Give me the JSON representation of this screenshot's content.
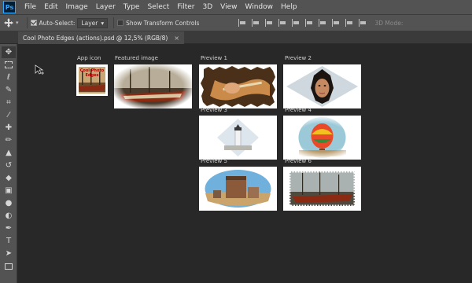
{
  "app": {
    "logo_text": "Ps"
  },
  "menu": [
    "File",
    "Edit",
    "Image",
    "Layer",
    "Type",
    "Select",
    "Filter",
    "3D",
    "View",
    "Window",
    "Help"
  ],
  "options": {
    "auto_select_label": "Auto-Select:",
    "auto_select_checked": true,
    "auto_select_value": "Layer",
    "show_transform_label": "Show Transform Controls",
    "show_transform_checked": false,
    "mode_3d_label": "3D Mode:"
  },
  "document_tab": {
    "title": "Cool Photo Edges (actions).psd @ 12,5% (RGB/8)",
    "close": "×"
  },
  "tools": [
    "move",
    "marquee",
    "lasso",
    "quick-select",
    "crop",
    "eyedropper",
    "healing",
    "brush",
    "stamp",
    "history-brush",
    "eraser",
    "gradient",
    "blur",
    "dodge",
    "pen",
    "type",
    "path-select",
    "rectangle"
  ],
  "canvas": {
    "labels": {
      "app_icon": "App icon",
      "featured_image": "Featured image",
      "preview_1": "Preview 1",
      "preview_2": "Preview 2",
      "preview_3": "Preview 3",
      "preview_4": "Preview 4",
      "preview_5": "Preview 5",
      "preview_6": "Preview 6"
    },
    "app_icon_overlay_text": "Cool Photo Edges"
  },
  "colors": {
    "chrome": "#535353",
    "canvas_bg": "#282828",
    "accent": "#31a8ff"
  }
}
